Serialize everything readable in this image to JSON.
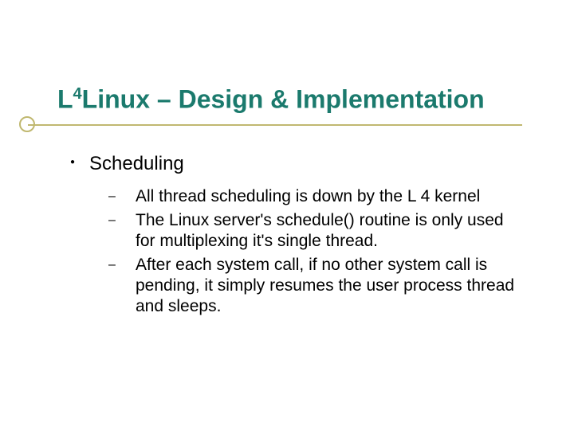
{
  "title": {
    "prefix": "L",
    "sup": "4",
    "rest": "Linux – Design & Implementation"
  },
  "section": "Scheduling",
  "items": [
    "All thread scheduling is down by the L 4 kernel",
    "The Linux server's schedule() routine is only used for multiplexing it's single thread.",
    "After each system call, if no other system call is pending, it simply resumes the user process thread and sleeps."
  ],
  "dash": "–"
}
